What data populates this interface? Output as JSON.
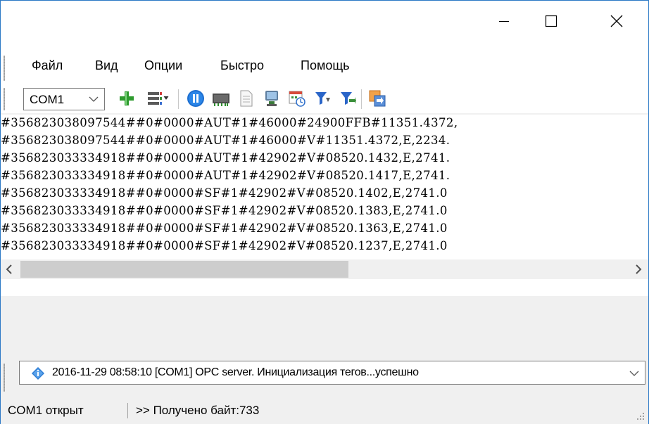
{
  "window": {
    "controls": {
      "minimize": "minimize",
      "maximize": "maximize",
      "close": "close"
    }
  },
  "menu": {
    "items": [
      {
        "label": "Файл"
      },
      {
        "label": "Вид"
      },
      {
        "label": "Опции"
      },
      {
        "label": "Быстро"
      },
      {
        "label": "Помощь"
      }
    ]
  },
  "toolbar": {
    "port_select": {
      "value": "COM1"
    },
    "buttons": [
      {
        "icon": "add-plus-icon"
      },
      {
        "icon": "list-menu-icon"
      },
      {
        "icon": "pause-icon"
      },
      {
        "icon": "device-board-icon"
      },
      {
        "icon": "document-icon"
      },
      {
        "icon": "terminal-monitor-icon"
      },
      {
        "icon": "schedule-icon"
      },
      {
        "icon": "filter-icon"
      },
      {
        "icon": "filter-add-icon"
      },
      {
        "icon": "export-icon"
      }
    ],
    "colors": {
      "plus": "#2e9b2e",
      "pause": "#1e6fd0",
      "filter": "#2a65c8",
      "export": "#e07a1c"
    }
  },
  "output": {
    "lines": [
      "#356823038097544##0#0000#AUT#1#46000#24900FFB#11351.4372,",
      "#356823038097544##0#0000#AUT#1#46000#V#11351.4372,E,2234.",
      "#356823033334918##0#0000#AUT#1#42902#V#08520.1432,E,2741.",
      "#356823033334918##0#0000#AUT#1#42902#V#08520.1417,E,2741.",
      "#356823033334918##0#0000#SF#1#42902#V#08520.1402,E,2741.0",
      "#356823033334918##0#0000#SF#1#42902#V#08520.1383,E,2741.0",
      "#356823033334918##0#0000#SF#1#42902#V#08520.1363,E,2741.0",
      "#356823033334918##0#0000#SF#1#42902#V#08520.1237,E,2741.0"
    ]
  },
  "log": {
    "entry": "2016-11-29 08:58:10 [COM1] OPC server. Инициализация тегов...успешно",
    "icon": "info-diamond-icon"
  },
  "status": {
    "port_state": "COM1 открыт",
    "bytes_received": ">> Получено байт:733"
  }
}
